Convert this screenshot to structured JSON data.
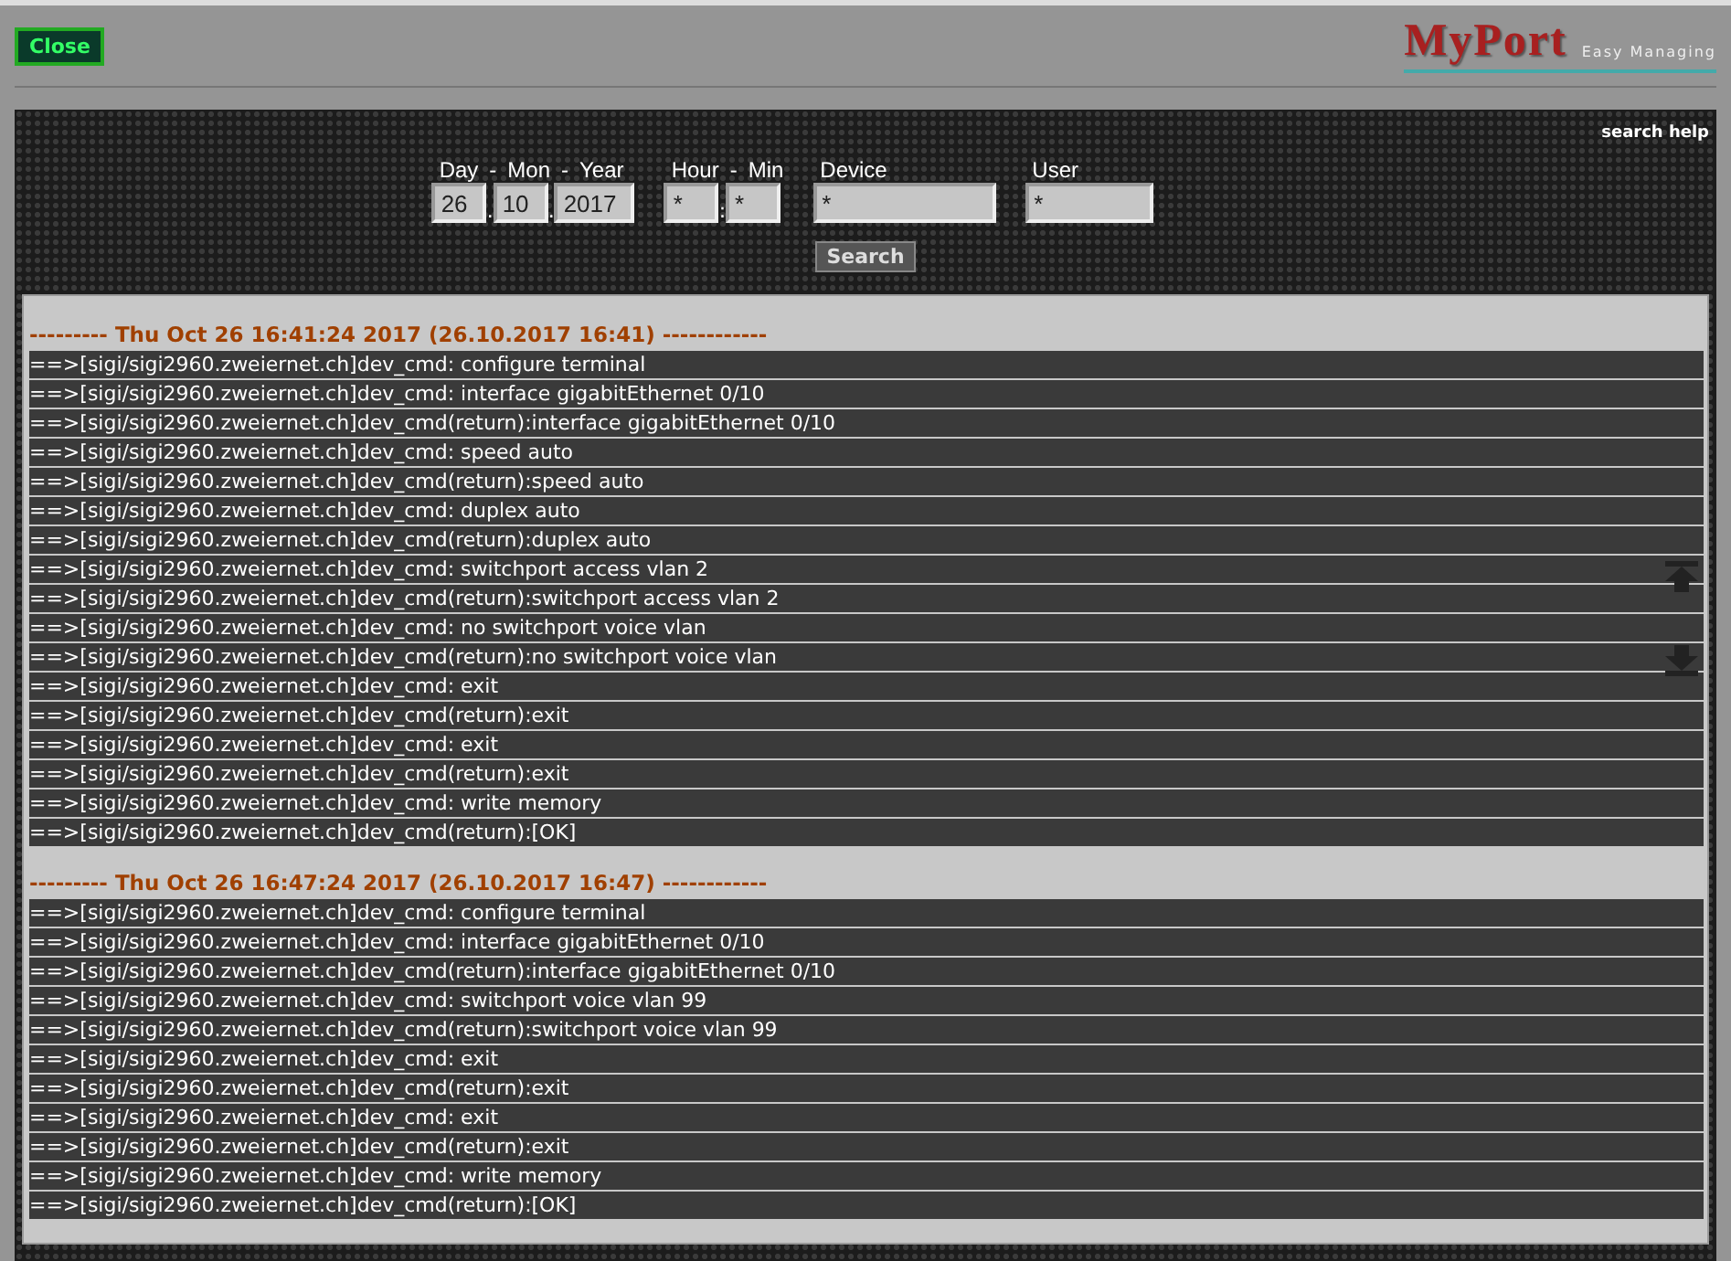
{
  "header": {
    "close_button": "Close",
    "logo": {
      "title": "MyPort",
      "tagline": "Easy Managing"
    }
  },
  "search_help": "search help",
  "form": {
    "groups": [
      {
        "labels": [
          "Day",
          "-",
          "Mon",
          "-",
          "Year"
        ],
        "fields": [
          {
            "value": "26",
            "sep": "."
          },
          {
            "value": "10",
            "sep": "."
          },
          {
            "value": "2017"
          }
        ]
      },
      {
        "labels": [
          "Hour",
          "-",
          "Min"
        ],
        "fields": [
          {
            "value": "*",
            "sep": ":"
          },
          {
            "value": "*"
          }
        ]
      },
      {
        "labels": [
          "Device"
        ],
        "fields": [
          {
            "value": "*"
          }
        ]
      },
      {
        "labels": [
          "User"
        ],
        "fields": [
          {
            "value": "*"
          }
        ]
      }
    ],
    "button": "Search"
  },
  "log": {
    "sections": [
      {
        "heading": "--------- Thu Oct 26 16:41:24 2017 (26.10.2017 16:41) ------------",
        "lines": [
          "==>[sigi/sigi2960.zweiernet.ch]dev_cmd: configure terminal",
          "==>[sigi/sigi2960.zweiernet.ch]dev_cmd: interface gigabitEthernet 0/10",
          "==>[sigi/sigi2960.zweiernet.ch]dev_cmd(return):interface gigabitEthernet 0/10",
          "==>[sigi/sigi2960.zweiernet.ch]dev_cmd: speed auto",
          "==>[sigi/sigi2960.zweiernet.ch]dev_cmd(return):speed auto",
          "==>[sigi/sigi2960.zweiernet.ch]dev_cmd: duplex auto",
          "==>[sigi/sigi2960.zweiernet.ch]dev_cmd(return):duplex auto",
          "==>[sigi/sigi2960.zweiernet.ch]dev_cmd: switchport access vlan 2",
          "==>[sigi/sigi2960.zweiernet.ch]dev_cmd(return):switchport access vlan 2",
          "==>[sigi/sigi2960.zweiernet.ch]dev_cmd: no switchport voice vlan",
          "==>[sigi/sigi2960.zweiernet.ch]dev_cmd(return):no switchport voice vlan",
          "==>[sigi/sigi2960.zweiernet.ch]dev_cmd: exit",
          "==>[sigi/sigi2960.zweiernet.ch]dev_cmd(return):exit",
          "==>[sigi/sigi2960.zweiernet.ch]dev_cmd: exit",
          "==>[sigi/sigi2960.zweiernet.ch]dev_cmd(return):exit",
          "==>[sigi/sigi2960.zweiernet.ch]dev_cmd: write memory",
          "==>[sigi/sigi2960.zweiernet.ch]dev_cmd(return):[OK]"
        ]
      },
      {
        "heading": "--------- Thu Oct 26 16:47:24 2017 (26.10.2017 16:47) ------------",
        "lines": [
          "==>[sigi/sigi2960.zweiernet.ch]dev_cmd: configure terminal",
          "==>[sigi/sigi2960.zweiernet.ch]dev_cmd: interface gigabitEthernet 0/10",
          "==>[sigi/sigi2960.zweiernet.ch]dev_cmd(return):interface gigabitEthernet 0/10",
          "==>[sigi/sigi2960.zweiernet.ch]dev_cmd: switchport voice vlan 99",
          "==>[sigi/sigi2960.zweiernet.ch]dev_cmd(return):switchport voice vlan 99",
          "==>[sigi/sigi2960.zweiernet.ch]dev_cmd: exit",
          "==>[sigi/sigi2960.zweiernet.ch]dev_cmd(return):exit",
          "==>[sigi/sigi2960.zweiernet.ch]dev_cmd: exit",
          "==>[sigi/sigi2960.zweiernet.ch]dev_cmd(return):exit",
          "==>[sigi/sigi2960.zweiernet.ch]dev_cmd: write memory",
          "==>[sigi/sigi2960.zweiernet.ch]dev_cmd(return):[OK]"
        ]
      }
    ]
  }
}
